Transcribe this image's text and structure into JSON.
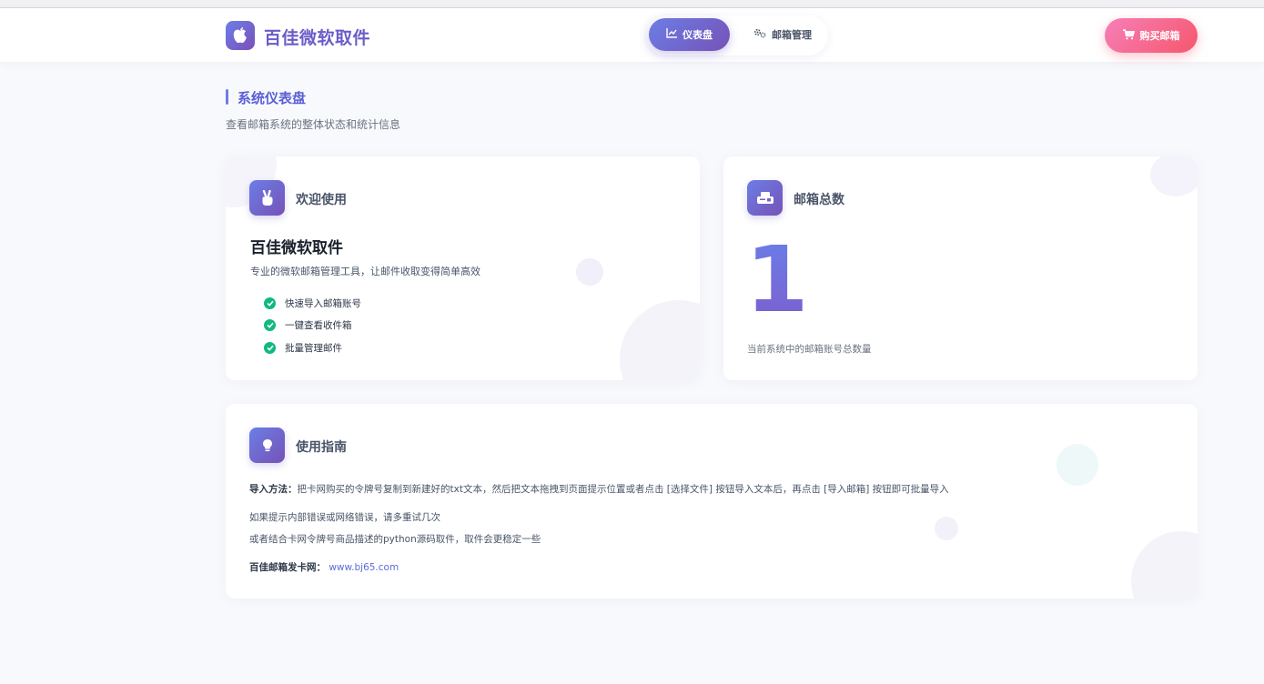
{
  "header": {
    "brand": "百佳微软取件",
    "nav": [
      {
        "label": "仪表盘",
        "icon": "chart-line-icon",
        "active": true
      },
      {
        "label": "邮箱管理",
        "icon": "gears-icon",
        "active": false
      }
    ],
    "buy_label": "购买邮箱",
    "buy_icon": "cart-icon"
  },
  "page": {
    "title": "系统仪表盘",
    "subtitle": "查看邮箱系统的整体状态和统计信息"
  },
  "welcome_card": {
    "title": "欢迎使用",
    "icon": "peace-hand-icon",
    "heading": "百佳微软取件",
    "desc": "专业的微软邮箱管理工具，让邮件收取变得简单高效",
    "features": [
      "快速导入邮箱账号",
      "一键查看收件箱",
      "批量管理邮件"
    ]
  },
  "total_card": {
    "title": "邮箱总数",
    "icon": "mailbox-icon",
    "value": "1",
    "desc": "当前系统中的邮箱账号总数量"
  },
  "guide_card": {
    "title": "使用指南",
    "icon": "lightbulb-icon",
    "import_label": "导入方法：",
    "import_text": "把卡网购买的令牌号复制到新建好的txt文本，然后把文本拖拽到页面提示位置或者点击 [选择文件] 按钮导入文本后，再点击 [导入邮箱] 按钮即可批量导入",
    "line2": "如果提示内部错误或网络错误，请多重试几次",
    "line3": "或者结合卡网令牌号商品描述的python源码取件，取件会更稳定一些",
    "site_label": "百佳邮箱发卡网：",
    "site_link": "www.bj65.com"
  },
  "colors": {
    "accent": "#6b7ee6",
    "accent2": "#7652b6",
    "buy": "#f5576c",
    "check": "#10b981"
  }
}
